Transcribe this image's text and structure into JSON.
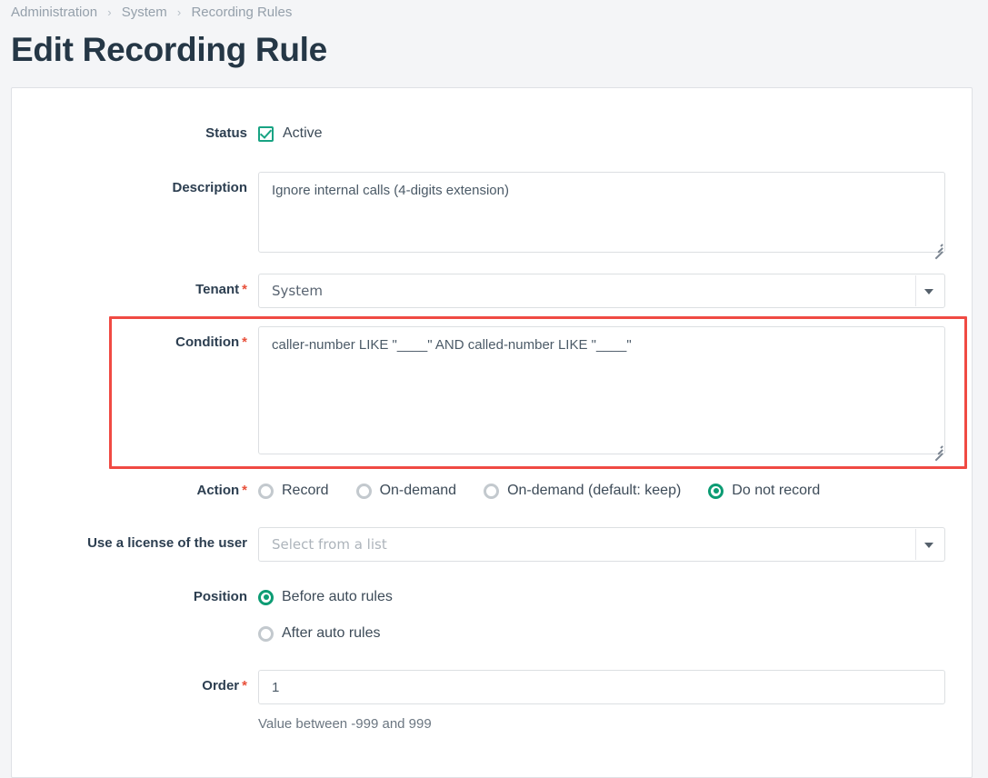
{
  "breadcrumb": {
    "items": [
      "Administration",
      "System",
      "Recording Rules"
    ],
    "separator": "›"
  },
  "page": {
    "title": "Edit Recording Rule"
  },
  "form": {
    "status": {
      "label": "Status",
      "checkbox_label": "Active",
      "checked": true,
      "check_color": "#18a383"
    },
    "description": {
      "label": "Description",
      "value": "Ignore internal calls (4-digits extension)"
    },
    "tenant": {
      "label": "Tenant",
      "required_marker": "*",
      "value": "System"
    },
    "condition": {
      "label": "Condition",
      "required_marker": "*",
      "value": "caller-number LIKE \"____\" AND called-number LIKE \"____\"",
      "highlight_color": "#f04a43"
    },
    "action": {
      "label": "Action",
      "required_marker": "*",
      "options": [
        {
          "label": "Record",
          "selected": false
        },
        {
          "label": "On-demand",
          "selected": false
        },
        {
          "label": "On-demand (default: keep)",
          "selected": false
        },
        {
          "label": "Do not record",
          "selected": true
        }
      ],
      "selected_color": "#0d9c74"
    },
    "license": {
      "label": "Use a license of the user",
      "placeholder": "Select from a list",
      "value": ""
    },
    "position": {
      "label": "Position",
      "options": [
        {
          "label": "Before auto rules",
          "selected": true
        },
        {
          "label": "After auto rules",
          "selected": false
        }
      ]
    },
    "order": {
      "label": "Order",
      "required_marker": "*",
      "value": "1",
      "hint": "Value between -999 and 999"
    }
  }
}
